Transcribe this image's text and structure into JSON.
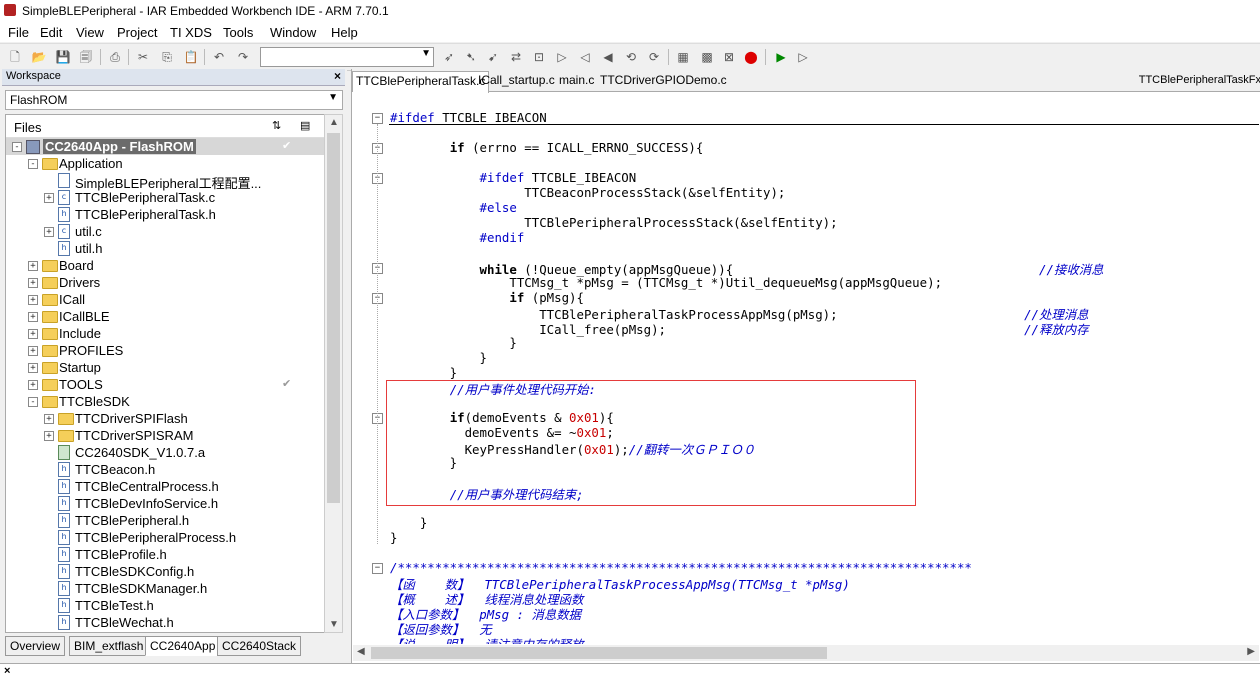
{
  "window": {
    "title": "SimpleBLEPeripheral - IAR Embedded Workbench IDE - ARM 7.70.1"
  },
  "menu": [
    "File",
    "Edit",
    "View",
    "Project",
    "TI XDS",
    "Tools",
    "Window",
    "Help"
  ],
  "workspace": {
    "panel_title": "Workspace",
    "configuration": "FlashROM",
    "files_header": "Files",
    "tree": [
      {
        "label": "CC2640App - FlashROM",
        "depth": 0,
        "kind": "project",
        "expander": "-",
        "selected": true,
        "check": "✔"
      },
      {
        "label": "Application",
        "depth": 1,
        "kind": "folder",
        "expander": "-"
      },
      {
        "label": "SimpleBLEPeripheral工程配置...",
        "depth": 2,
        "kind": "doc",
        "expander": ""
      },
      {
        "label": "TTCBlePeripheralTask.c",
        "depth": 2,
        "kind": "c",
        "expander": "+"
      },
      {
        "label": "TTCBlePeripheralTask.h",
        "depth": 2,
        "kind": "h",
        "expander": ""
      },
      {
        "label": "util.c",
        "depth": 2,
        "kind": "c",
        "expander": "+"
      },
      {
        "label": "util.h",
        "depth": 2,
        "kind": "h",
        "expander": ""
      },
      {
        "label": "Board",
        "depth": 1,
        "kind": "folder",
        "expander": "+"
      },
      {
        "label": "Drivers",
        "depth": 1,
        "kind": "folder",
        "expander": "+"
      },
      {
        "label": "ICall",
        "depth": 1,
        "kind": "folder",
        "expander": "+"
      },
      {
        "label": "ICallBLE",
        "depth": 1,
        "kind": "folder",
        "expander": "+"
      },
      {
        "label": "Include",
        "depth": 1,
        "kind": "folder",
        "expander": "+"
      },
      {
        "label": "PROFILES",
        "depth": 1,
        "kind": "folder",
        "expander": "+"
      },
      {
        "label": "Startup",
        "depth": 1,
        "kind": "folder",
        "expander": "+"
      },
      {
        "label": "TOOLS",
        "depth": 1,
        "kind": "folder",
        "expander": "+",
        "check": "✔"
      },
      {
        "label": "TTCBleSDK",
        "depth": 1,
        "kind": "folder",
        "expander": "-"
      },
      {
        "label": "TTCDriverSPIFlash",
        "depth": 2,
        "kind": "folder",
        "expander": "+"
      },
      {
        "label": "TTCDriverSPISRAM",
        "depth": 2,
        "kind": "folder",
        "expander": "+"
      },
      {
        "label": "CC2640SDK_V1.0.7.a",
        "depth": 2,
        "kind": "lib",
        "expander": ""
      },
      {
        "label": "TTCBeacon.h",
        "depth": 2,
        "kind": "h",
        "expander": ""
      },
      {
        "label": "TTCBleCentralProcess.h",
        "depth": 2,
        "kind": "h",
        "expander": ""
      },
      {
        "label": "TTCBleDevInfoService.h",
        "depth": 2,
        "kind": "h",
        "expander": ""
      },
      {
        "label": "TTCBlePeripheral.h",
        "depth": 2,
        "kind": "h",
        "expander": ""
      },
      {
        "label": "TTCBlePeripheralProcess.h",
        "depth": 2,
        "kind": "h",
        "expander": ""
      },
      {
        "label": "TTCBleProfile.h",
        "depth": 2,
        "kind": "h",
        "expander": ""
      },
      {
        "label": "TTCBleSDKConfig.h",
        "depth": 2,
        "kind": "h",
        "expander": ""
      },
      {
        "label": "TTCBleSDKManager.h",
        "depth": 2,
        "kind": "h",
        "expander": ""
      },
      {
        "label": "TTCBleTest.h",
        "depth": 2,
        "kind": "h",
        "expander": ""
      },
      {
        "label": "TTCBleWechat.h",
        "depth": 2,
        "kind": "h",
        "expander": ""
      }
    ],
    "bottom_tabs": [
      "Overview",
      "BIM_extflash",
      "CC2640App",
      "CC2640Stack"
    ],
    "active_bottom_tab": "CC2640App"
  },
  "editor": {
    "tabs": [
      "TTCBlePeripheralTask.c",
      "ICall_startup.c",
      "main.c",
      "TTCDriverGPIODemo.c"
    ],
    "active_tab": "TTCBlePeripheralTask.c",
    "right_label": "TTCBlePeripheralTaskFx"
  },
  "code_lines": [
    [
      [
        "pp",
        "#ifdef"
      ],
      [
        "t",
        " TTCBLE_IBEACON"
      ]
    ],
    [],
    [
      [
        "t",
        "        "
      ],
      [
        "kw",
        "if"
      ],
      [
        "t",
        " (errno == ICALL_ERRNO_SUCCESS){"
      ]
    ],
    [],
    [
      [
        "t",
        "            "
      ],
      [
        "pp",
        "#ifdef"
      ],
      [
        "t",
        " TTCBLE_IBEACON"
      ]
    ],
    [
      [
        "t",
        "                  TTCBeaconProcessStack(&selfEntity);"
      ]
    ],
    [
      [
        "t",
        "            "
      ],
      [
        "pp",
        "#else"
      ]
    ],
    [
      [
        "t",
        "                  TTCBlePeripheralProcessStack(&selfEntity);"
      ]
    ],
    [
      [
        "t",
        "            "
      ],
      [
        "pp",
        "#endif"
      ]
    ],
    [],
    [
      [
        "t",
        "            "
      ],
      [
        "kw",
        "while"
      ],
      [
        "t",
        " (!Queue_empty(appMsgQueue)){                                         "
      ],
      [
        "cm",
        "//接收消息"
      ]
    ],
    [
      [
        "t",
        "                TTCMsg_t *pMsg = (TTCMsg_t *)Util_dequeueMsg(appMsgQueue);"
      ]
    ],
    [
      [
        "t",
        "                "
      ],
      [
        "kw",
        "if"
      ],
      [
        "t",
        " (pMsg){"
      ]
    ],
    [
      [
        "t",
        "                    TTCBlePeripheralTaskProcessAppMsg(pMsg);                         "
      ],
      [
        "cm",
        "//处理消息"
      ]
    ],
    [
      [
        "t",
        "                    ICall_free(pMsg);                                                "
      ],
      [
        "cm",
        "//释放内存"
      ]
    ],
    [
      [
        "t",
        "                }"
      ]
    ],
    [
      [
        "t",
        "            }"
      ]
    ],
    [
      [
        "t",
        "        }"
      ]
    ],
    [
      [
        "t",
        "        "
      ],
      [
        "cm",
        "//用户事件处理代码开始:"
      ]
    ],
    [],
    [
      [
        "t",
        "        "
      ],
      [
        "kw",
        "if"
      ],
      [
        "t",
        "(demoEvents & "
      ],
      [
        "num",
        "0x01"
      ],
      [
        "t",
        "){"
      ]
    ],
    [
      [
        "t",
        "          demoEvents &= ~"
      ],
      [
        "num",
        "0x01"
      ],
      [
        "t",
        ";"
      ]
    ],
    [
      [
        "t",
        "          KeyPressHandler("
      ],
      [
        "num",
        "0x01"
      ],
      [
        "t",
        ");"
      ],
      [
        "cm",
        "//翻转一次ＧＰＩＯ０"
      ]
    ],
    [
      [
        "t",
        "        }"
      ]
    ],
    [],
    [
      [
        "t",
        "        "
      ],
      [
        "cm",
        "//用户事外理代码结束;"
      ]
    ],
    [],
    [
      [
        "t",
        "    }"
      ]
    ],
    [
      [
        "t",
        "}"
      ]
    ],
    [],
    [
      [
        "cm",
        "/*****************************************************************************"
      ]
    ],
    [
      [
        "cm",
        "【函    数】  TTCBlePeripheralTaskProcessAppMsg(TTCMsg_t *pMsg)"
      ]
    ],
    [
      [
        "cm",
        "【概    述】  线程消息处理函数"
      ]
    ],
    [
      [
        "cm",
        "【入口参数】  pMsg : 消息数据"
      ]
    ],
    [
      [
        "cm",
        "【返回参数】  无"
      ]
    ],
    [
      [
        "cm",
        "【说    明】  请注意内存的释放"
      ]
    ]
  ]
}
